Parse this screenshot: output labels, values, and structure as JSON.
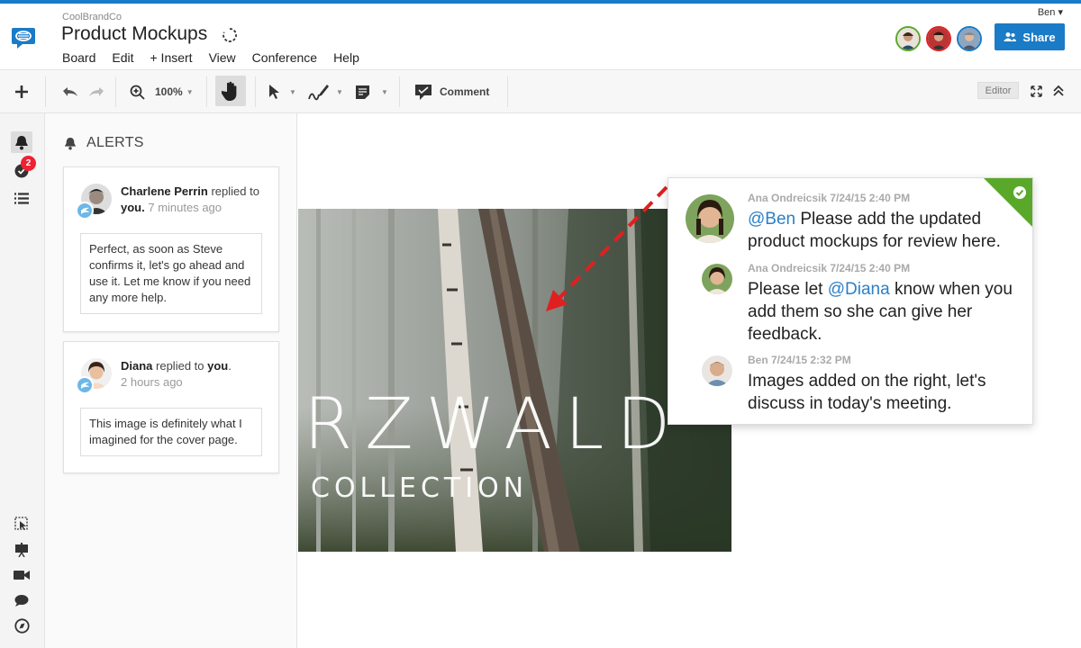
{
  "header": {
    "company": "CoolBrandCo",
    "title": "Product Mockups",
    "user": "Ben ▾",
    "menu": [
      "Board",
      "Edit",
      "+ Insert",
      "View",
      "Conference",
      "Help"
    ],
    "share_label": "Share"
  },
  "toolbar": {
    "zoom": "100%",
    "comment_label": "Comment",
    "editor_label": "Editor"
  },
  "alerts": {
    "title": "ALERTS",
    "badge_count": "2",
    "items": [
      {
        "name": "Charlene Perrin",
        "action": " replied to",
        "target": "you.",
        "time": " 7 minutes ago",
        "text": "Perfect, as soon as Steve confirms it, let's go ahead and use it. Let me know if you need any more help."
      },
      {
        "name": "Diana",
        "action": " replied to ",
        "target": "you",
        "punct": ".",
        "time": "2 hours ago",
        "text": "This image is definitely what I imagined for the cover page."
      }
    ]
  },
  "canvas": {
    "photo_text_1": "RZWALD",
    "photo_text_2": "COLLECTION"
  },
  "thread": {
    "messages": [
      {
        "meta": "Ana Ondreicsik 7/24/15 2:40 PM",
        "mention": "@Ben",
        "text": " Please add the updated product mockups for review here."
      },
      {
        "meta": "Ana Ondreicsik 7/24/15 2:40 PM",
        "pre": "Please let ",
        "mention": "@Diana",
        "text": " know when you add them so she can give her feedback."
      },
      {
        "meta": "Ben 7/24/15 2:32 PM",
        "text": "Images added on the right, let's discuss in today's meeting."
      }
    ]
  },
  "colors": {
    "accent": "#1a7bc7",
    "resolved": "#5aa82a",
    "alert_badge": "#e23",
    "mention": "#2a80c8"
  }
}
